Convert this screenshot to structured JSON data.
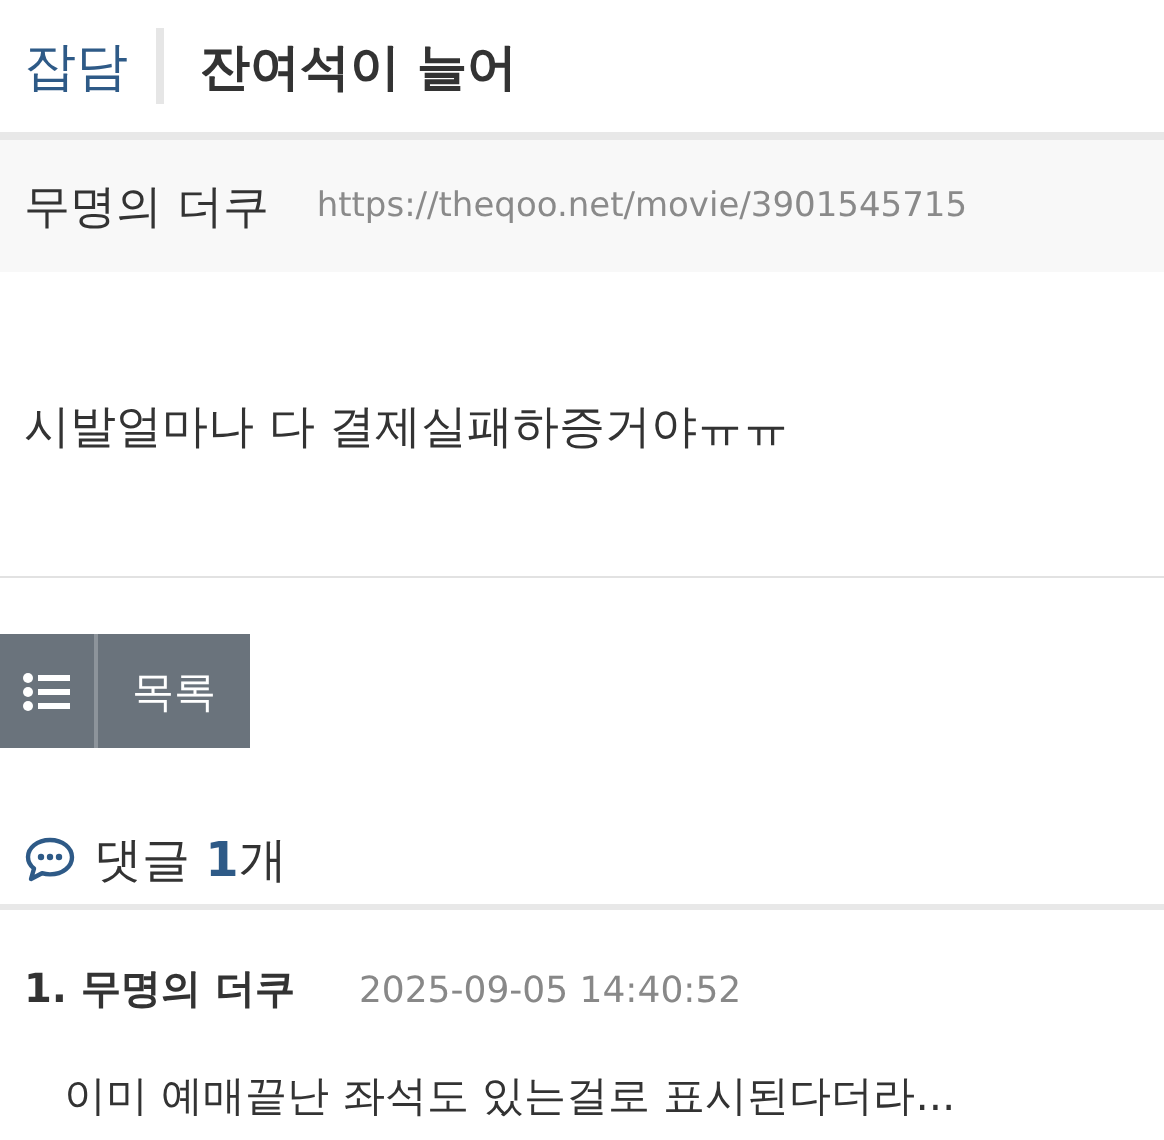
{
  "header": {
    "category": "잡담",
    "title": "잔여석이 늘어"
  },
  "meta": {
    "author": "무명의 더쿠",
    "url": "https://theqoo.net/movie/3901545715"
  },
  "post": {
    "body": "시발얼마나 다 결제실패하증거야ㅠㅠ"
  },
  "list_button": {
    "label": "목록"
  },
  "comments_heading": "댓글 **1**개",
  "comments": [
    {
      "number_author": "1. 무명의 더쿠",
      "time": "2025-09-05 14:40:52",
      "text": "이미 예매끝난 좌석도 있는걸로 표시된다더라..."
    }
  ]
}
